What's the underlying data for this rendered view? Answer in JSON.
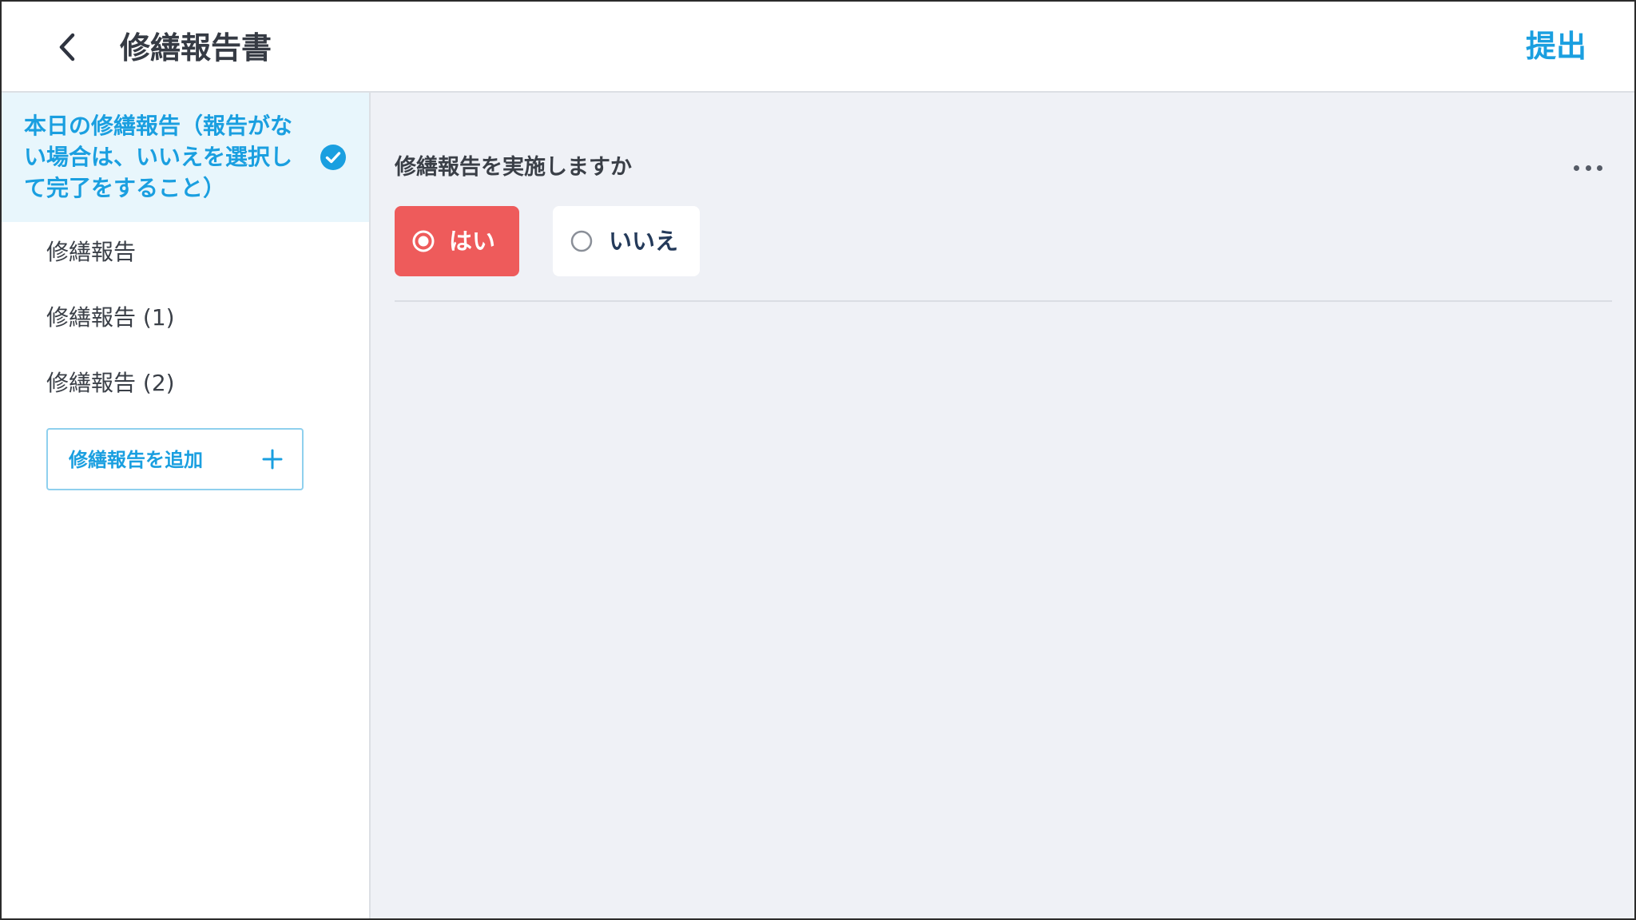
{
  "header": {
    "title": "修繕報告書",
    "submit_label": "提出"
  },
  "sidebar": {
    "active_section": {
      "label": "本日の修繕報告（報告がない場合は、いいえを選択して完了をすること）",
      "completed": true
    },
    "items": [
      {
        "label": "修繕報告"
      },
      {
        "label": "修繕報告 (1)"
      },
      {
        "label": "修繕報告 (2)"
      }
    ],
    "add_button_label": "修繕報告を追加"
  },
  "main": {
    "question": "修繕報告を実施しますか",
    "options": [
      {
        "label": "はい",
        "selected": true
      },
      {
        "label": "いいえ",
        "selected": false
      }
    ]
  },
  "colors": {
    "accent": "#1a9fe0",
    "selected_option": "#ee5b5b",
    "main_background": "#eff1f6",
    "active_section_background": "#e8f6fc"
  },
  "icons": {
    "back": "chevron-left-icon",
    "check": "check-circle-icon",
    "add": "plus-icon",
    "more": "more-horizontal-icon"
  }
}
